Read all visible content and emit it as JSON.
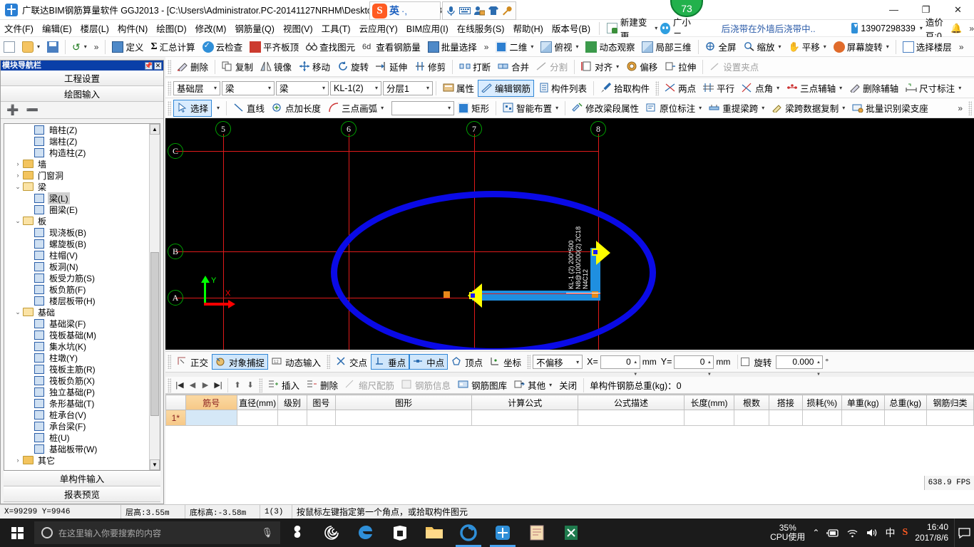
{
  "window": {
    "title": "广联达BIM钢筋算量软件 GGJ2013 - [C:\\Users\\Administrator.PC-20141127NRHM\\Desktop\\白龙村-2016-08-25-13-27-07(216",
    "minimize": "—",
    "maximize": "❐",
    "close": "✕"
  },
  "ime": {
    "logo": "S",
    "mode": "英",
    "comma": "·,",
    "mic": "mic-icon",
    "keyboard": "keyboard-icon",
    "toolbox": "toolbox-icon",
    "skin": "skin-icon",
    "wrench": "wrench-icon"
  },
  "badge": {
    "value": "73"
  },
  "menu": {
    "items": [
      "文件(F)",
      "编辑(E)",
      "楼层(L)",
      "构件(N)",
      "绘图(D)",
      "修改(M)",
      "钢筋量(Q)",
      "视图(V)",
      "工具(T)",
      "云应用(Y)",
      "BIM应用(I)",
      "在线服务(S)",
      "帮助(H)",
      "版本号(B)"
    ],
    "new_change": "新建变更",
    "assistant": "广小二",
    "notice": "后浇带在外墙后浇带中..",
    "phone": "13907298339",
    "coins": "造价豆:0",
    "overflow": "»"
  },
  "toolbar1": {
    "items": [
      {
        "label": "",
        "icon": "new-file-icon"
      },
      {
        "label": "",
        "icon": "open-folder-icon"
      },
      {
        "label": "",
        "icon": "save-icon"
      },
      {
        "label": "",
        "icon": "undo-icon"
      }
    ],
    "group2": [
      {
        "label": "定义",
        "icon": "define-icon"
      },
      {
        "label": "汇总计算",
        "icon": "sigma-icon"
      },
      {
        "label": "云检查",
        "icon": "cloud-check-icon"
      },
      {
        "label": "平齐板顶",
        "icon": "align-slab-icon"
      },
      {
        "label": "查找图元",
        "icon": "binoculars-icon"
      },
      {
        "label": "查看钢筋量",
        "icon": "view-rebar-icon"
      },
      {
        "label": "批量选择",
        "icon": "batch-select-icon"
      }
    ],
    "group3": [
      {
        "label": "二维",
        "icon": "2d-icon",
        "caret": true
      },
      {
        "label": "俯视",
        "icon": "topview-icon",
        "caret": true
      },
      {
        "label": "动态观察",
        "icon": "orbit-icon"
      },
      {
        "label": "局部三维",
        "icon": "local3d-icon"
      },
      {
        "label": "全屏",
        "icon": "fullscreen-icon"
      },
      {
        "label": "缩放",
        "icon": "zoom-icon",
        "caret": true
      },
      {
        "label": "平移",
        "icon": "pan-icon",
        "caret": true
      },
      {
        "label": "屏幕旋转",
        "icon": "screen-rotate-icon",
        "caret": true
      },
      {
        "label": "选择楼层",
        "icon": "select-floor-icon"
      }
    ]
  },
  "toolbar2": {
    "items": [
      {
        "label": "删除",
        "icon": "delete-icon"
      },
      {
        "label": "复制",
        "icon": "copy-icon"
      },
      {
        "label": "镜像",
        "icon": "mirror-icon"
      },
      {
        "label": "移动",
        "icon": "move-icon"
      },
      {
        "label": "旋转",
        "icon": "rotate-icon"
      },
      {
        "label": "延伸",
        "icon": "extend-icon"
      },
      {
        "label": "修剪",
        "icon": "trim-icon"
      },
      {
        "label": "打断",
        "icon": "break-icon"
      },
      {
        "label": "合并",
        "icon": "merge-icon"
      },
      {
        "label": "分割",
        "icon": "split-icon",
        "disabled": true
      },
      {
        "label": "对齐",
        "icon": "align-icon",
        "caret": true
      },
      {
        "label": "偏移",
        "icon": "offset-icon"
      },
      {
        "label": "拉伸",
        "icon": "stretch-icon"
      },
      {
        "label": "设置夹点",
        "icon": "set-grip-icon",
        "disabled": true
      }
    ]
  },
  "toolbar3": {
    "floor": "基础层",
    "category": "梁",
    "type": "梁",
    "component": "KL-1(2)",
    "layer": "分层1",
    "buttons": [
      {
        "label": "属性",
        "icon": "properties-icon"
      },
      {
        "label": "编辑钢筋",
        "icon": "edit-rebar-icon",
        "active": true
      },
      {
        "label": "构件列表",
        "icon": "component-list-icon"
      },
      {
        "label": "拾取构件",
        "icon": "pick-component-icon"
      }
    ],
    "axis_tools": [
      {
        "label": "两点",
        "icon": "two-point-icon"
      },
      {
        "label": "平行",
        "icon": "parallel-icon"
      },
      {
        "label": "点角",
        "icon": "point-angle-icon",
        "caret": true
      },
      {
        "label": "三点辅轴",
        "icon": "three-point-axis-icon",
        "caret": true
      },
      {
        "label": "删除辅轴",
        "icon": "delete-axis-icon"
      },
      {
        "label": "尺寸标注",
        "icon": "dimension-icon",
        "caret": true
      }
    ]
  },
  "toolbar4": {
    "select": "选择",
    "draw": [
      {
        "label": "直线",
        "icon": "line-icon"
      },
      {
        "label": "点加长度",
        "icon": "point-length-icon"
      },
      {
        "label": "三点画弧",
        "icon": "three-point-arc-icon",
        "caret": true
      }
    ],
    "combo_value": "",
    "rect": "矩形",
    "smart": "智能布置",
    "beam_tools": [
      {
        "label": "修改梁段属性",
        "icon": "edit-beam-seg-icon"
      },
      {
        "label": "原位标注",
        "icon": "in-situ-label-icon",
        "caret": true
      },
      {
        "label": "重提梁跨",
        "icon": "respan-beam-icon",
        "caret": true
      },
      {
        "label": "梁跨数据复制",
        "icon": "copy-span-data-icon",
        "caret": true
      },
      {
        "label": "批量识别梁支座",
        "icon": "batch-beam-support-icon"
      }
    ],
    "overflow": "»"
  },
  "navigator": {
    "title": "模块导航栏",
    "pin": "pin-icon",
    "close": "close-icon",
    "top_buttons": [
      "工程设置",
      "绘图输入"
    ],
    "bottom_buttons": [
      "单构件输入",
      "报表预览"
    ],
    "expand_all": "expand-all-icon",
    "collapse_all": "collapse-all-icon",
    "tree": [
      {
        "label": "暗柱(Z)",
        "level": 2,
        "icon": "dark-column-icon"
      },
      {
        "label": "端柱(Z)",
        "level": 2,
        "icon": "end-column-icon"
      },
      {
        "label": "构造柱(Z)",
        "level": 2,
        "icon": "structural-column-icon"
      },
      {
        "label": "墙",
        "level": 1,
        "icon": "folder-icon",
        "expander": "collapsed"
      },
      {
        "label": "门窗洞",
        "level": 1,
        "icon": "folder-icon",
        "expander": "collapsed"
      },
      {
        "label": "梁",
        "level": 1,
        "icon": "folder-open-icon",
        "expander": "expanded"
      },
      {
        "label": "梁(L)",
        "level": 2,
        "icon": "beam-icon",
        "selected": true
      },
      {
        "label": "圈梁(E)",
        "level": 2,
        "icon": "ring-beam-icon"
      },
      {
        "label": "板",
        "level": 1,
        "icon": "folder-open-icon",
        "expander": "expanded"
      },
      {
        "label": "现浇板(B)",
        "level": 2,
        "icon": "cast-slab-icon"
      },
      {
        "label": "螺旋板(B)",
        "level": 2,
        "icon": "spiral-slab-icon"
      },
      {
        "label": "柱帽(V)",
        "level": 2,
        "icon": "column-cap-icon"
      },
      {
        "label": "板洞(N)",
        "level": 2,
        "icon": "slab-hole-icon"
      },
      {
        "label": "板受力筋(S)",
        "level": 2,
        "icon": "slab-main-rebar-icon"
      },
      {
        "label": "板负筋(F)",
        "level": 2,
        "icon": "slab-neg-rebar-icon"
      },
      {
        "label": "楼层板带(H)",
        "level": 2,
        "icon": "floor-band-icon"
      },
      {
        "label": "基础",
        "level": 1,
        "icon": "folder-open-icon",
        "expander": "expanded"
      },
      {
        "label": "基础梁(F)",
        "level": 2,
        "icon": "foundation-beam-icon"
      },
      {
        "label": "筏板基础(M)",
        "level": 2,
        "icon": "raft-foundation-icon"
      },
      {
        "label": "集水坑(K)",
        "level": 2,
        "icon": "sump-icon"
      },
      {
        "label": "柱墩(Y)",
        "level": 2,
        "icon": "column-pier-icon"
      },
      {
        "label": "筏板主筋(R)",
        "level": 2,
        "icon": "raft-main-rebar-icon"
      },
      {
        "label": "筏板负筋(X)",
        "level": 2,
        "icon": "raft-neg-rebar-icon"
      },
      {
        "label": "独立基础(P)",
        "level": 2,
        "icon": "isolated-foundation-icon"
      },
      {
        "label": "条形基础(T)",
        "level": 2,
        "icon": "strip-foundation-icon"
      },
      {
        "label": "桩承台(V)",
        "level": 2,
        "icon": "pile-cap-icon"
      },
      {
        "label": "承台梁(F)",
        "level": 2,
        "icon": "cap-beam-icon"
      },
      {
        "label": "桩(U)",
        "level": 2,
        "icon": "pile-icon"
      },
      {
        "label": "基础板带(W)",
        "level": 2,
        "icon": "foundation-band-icon"
      },
      {
        "label": "其它",
        "level": 1,
        "icon": "folder-icon",
        "expander": "collapsed"
      }
    ]
  },
  "canvas": {
    "vertical_axes": [
      "5",
      "6",
      "7",
      "8"
    ],
    "horizontal_axes": [
      "C",
      "B",
      "A"
    ],
    "ucs": {
      "x_label": "X",
      "y_label": "Y"
    },
    "beam_labels": [
      "KL-1 (2) 200*500",
      "N8@100/200(2) 2C18",
      "N4C12"
    ],
    "selection_shape": "ellipse"
  },
  "snapbar": {
    "modes": [
      {
        "label": "正交",
        "icon": "ortho-icon",
        "on": false
      },
      {
        "label": "对象捕捉",
        "icon": "object-snap-icon",
        "on": true
      },
      {
        "label": "动态输入",
        "icon": "dynamic-input-icon",
        "on": false
      }
    ],
    "snaps": [
      {
        "label": "交点",
        "icon": "intersection-icon",
        "on": false
      },
      {
        "label": "垂点",
        "icon": "perpendicular-icon",
        "on": true
      },
      {
        "label": "中点",
        "icon": "midpoint-icon",
        "on": true
      },
      {
        "label": "顶点",
        "icon": "vertex-icon",
        "on": false
      },
      {
        "label": "坐标",
        "icon": "coordinate-icon",
        "on": false
      }
    ],
    "offset_mode": "不偏移",
    "x_label": "X=",
    "x_value": "0",
    "x_unit": "mm",
    "y_label": "Y=",
    "y_value": "0",
    "y_unit": "mm",
    "rotate_label": "旋转",
    "rotate_value": "0.000",
    "rotate_unit": "°"
  },
  "rebar_toolbar": {
    "nav": [
      "|◀",
      "◀",
      "▶",
      "▶|",
      "⬆",
      "⬇"
    ],
    "buttons": [
      {
        "label": "插入",
        "icon": "insert-row-icon"
      },
      {
        "label": "删除",
        "icon": "delete-row-icon"
      },
      {
        "label": "缩尺配筋",
        "icon": "scale-rebar-icon",
        "disabled": true
      },
      {
        "label": "钢筋信息",
        "icon": "rebar-info-icon",
        "disabled": true
      },
      {
        "label": "钢筋图库",
        "icon": "rebar-library-icon"
      },
      {
        "label": "其他",
        "icon": "other-icon",
        "caret": true
      },
      {
        "label": "关闭",
        "icon": "close-panel-icon"
      }
    ],
    "total_weight": "单构件钢筋总重(kg)：0"
  },
  "table": {
    "columns": [
      "",
      "筋号",
      "直径(mm)",
      "级别",
      "图号",
      "图形",
      "计算公式",
      "公式描述",
      "长度(mm)",
      "根数",
      "搭接",
      "损耗(%)",
      "单重(kg)",
      "总重(kg)",
      "钢筋归类"
    ],
    "rows": [
      {
        "index": "1*",
        "cells": [
          "",
          "",
          "",
          "",
          "",
          "",
          "",
          "",
          "",
          "",
          "",
          "",
          "",
          ""
        ]
      }
    ]
  },
  "status": {
    "coords": "X=99299  Y=9946",
    "floor_height": "层高:3.55m",
    "bottom_elev": "底标高:-3.58m",
    "page": "1(3)",
    "message": "按鼠标左键指定第一个角点，或拾取构件图元",
    "fps": "638.9 FPS"
  },
  "taskbar": {
    "start": "start-icon",
    "search_placeholder": "在这里输入你要搜索的内容",
    "mic": "mic-icon",
    "apps": [
      "sogou-icon",
      "spiral-icon",
      "edge-icon",
      "store-icon",
      "explorer-icon",
      "chrome-icon",
      "glodon-icon",
      "notepad-icon",
      "excel-icon"
    ],
    "cpu_percent": "35%",
    "cpu_label": "CPU使用",
    "tray_chevron": "⌃",
    "battery": "battery-icon",
    "wifi": "wifi-icon",
    "volume": "volume-icon",
    "ime_mode": "中",
    "sogou": "S",
    "time": "16:40",
    "date": "2017/8/6",
    "notification": "notification-icon"
  },
  "colors": {
    "accent": "#2f86d6",
    "grid": "#e01a1a",
    "beam": "#1f8fe0",
    "selection": "#0a0ae6",
    "grip": "#e8881a",
    "title_blue": "#0a3fa8"
  }
}
